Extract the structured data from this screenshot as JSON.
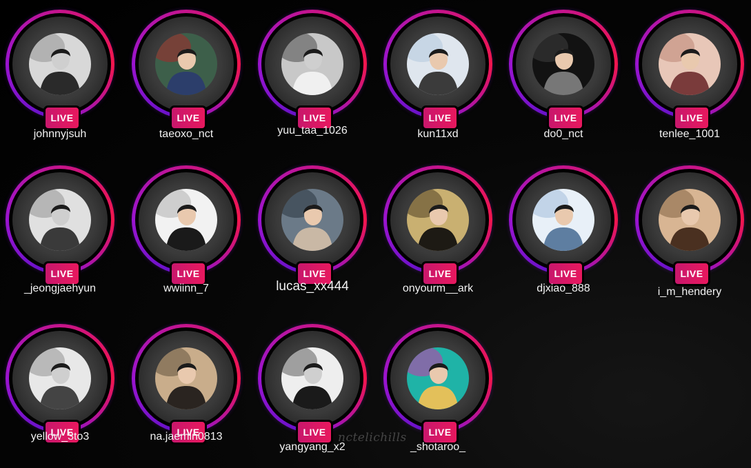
{
  "live_badge_label": "LIVE",
  "watermark": "nctelichills",
  "colors": {
    "ring_start": "#6a12c9",
    "ring_end": "#f2164d",
    "live_badge": "#e8185e",
    "background": "#000000"
  },
  "stories": [
    {
      "username": "johnnyjsuh"
    },
    {
      "username": "taeoxo_nct"
    },
    {
      "username": "yuu_taa_1026"
    },
    {
      "username": "kun11xd"
    },
    {
      "username": "do0_nct"
    },
    {
      "username": "tenlee_1001"
    },
    {
      "username": "_jeongjaehyun"
    },
    {
      "username": "wwiinn_7"
    },
    {
      "username": "lucas_xx444"
    },
    {
      "username": "onyourm__ark"
    },
    {
      "username": "djxiao_888"
    },
    {
      "username": "i_m_hendery"
    },
    {
      "username": "yellow_3to3"
    },
    {
      "username": "na.jaemin0813"
    },
    {
      "username": "yangyang_x2"
    },
    {
      "username": "_shotaroo_"
    }
  ]
}
